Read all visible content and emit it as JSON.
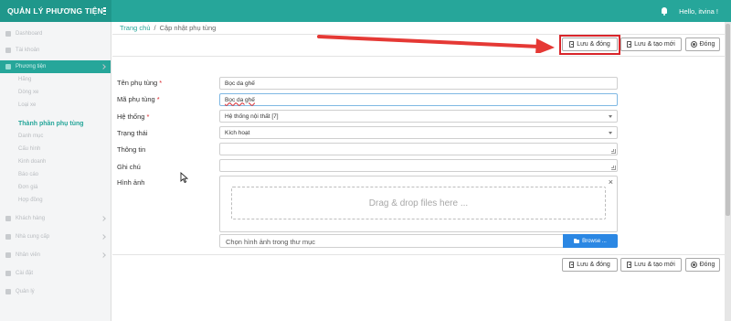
{
  "header": {
    "app_title": "QUẢN LÝ PHƯƠNG TIỆN",
    "user_greeting": "Hello, itvina !"
  },
  "sidebar": {
    "items": [
      {
        "label": "Dashboard"
      },
      {
        "label": "Tài khoản"
      },
      {
        "label": "Phương tiện"
      },
      {
        "label": "Hãng"
      },
      {
        "label": "Dòng xe"
      },
      {
        "label": "Loại xe"
      },
      {
        "label": "Thành phần phụ tùng"
      },
      {
        "label": "Danh mục"
      },
      {
        "label": "Cấu hình"
      },
      {
        "label": "Kinh doanh"
      },
      {
        "label": "Báo cáo"
      },
      {
        "label": "Đơn giá"
      },
      {
        "label": "Hợp đồng"
      },
      {
        "label": "Khách hàng"
      },
      {
        "label": "Nhà cung cấp"
      },
      {
        "label": "Nhân viên"
      },
      {
        "label": "Cài đặt"
      },
      {
        "label": "Quản lý"
      }
    ]
  },
  "breadcrumb": {
    "home": "Trang chủ",
    "separator": "/",
    "current": "Cập nhật phụ tùng"
  },
  "toolbar": {
    "save_close": "Lưu & đóng",
    "save_new": "Lưu & tạo mới",
    "close": "Đóng"
  },
  "form": {
    "name_label": "Tên phụ tùng",
    "name_value": "Bọc da ghế",
    "code_label": "Mã phụ tùng",
    "code_value": "Bọc da ghế",
    "system_label": "Hệ thống",
    "system_value": "Hệ thống nội thất [7]",
    "status_label": "Trạng thái",
    "status_value": "Kích hoạt",
    "info_label": "Thông tin",
    "info_value": "",
    "note_label": "Ghi chú",
    "note_value": "",
    "image_label": "Hình ảnh",
    "required_mark": "*",
    "dropzone_text": "Drag & drop files here ...",
    "file_placeholder": "Chọn hình ảnh trong thư mục",
    "browse_label": "Browse ...",
    "close_symbol": "×"
  },
  "colors": {
    "primary": "#26a69a",
    "required": "#d9262b",
    "browse": "#2b87e3",
    "annotation": "#e53935"
  }
}
